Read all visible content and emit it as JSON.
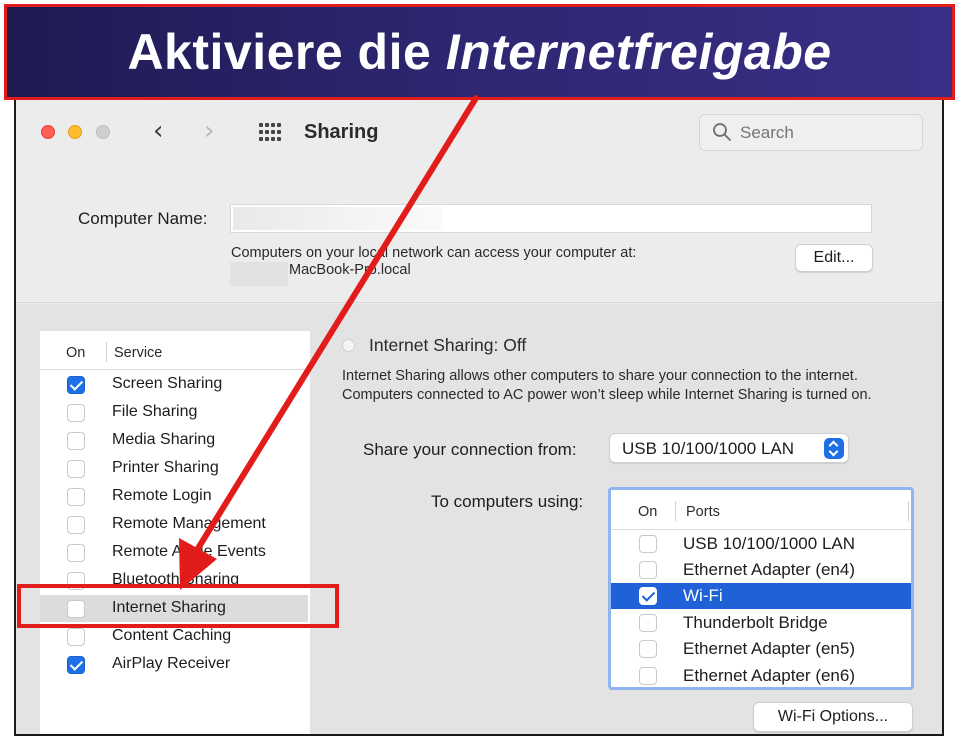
{
  "banner": {
    "title_plain": "Aktiviere die ",
    "title_emph": "Internetfreigabe"
  },
  "window": {
    "title": "Sharing",
    "search_placeholder": "Search"
  },
  "computer_name": {
    "label": "Computer Name:",
    "value": "",
    "info": "Computers on your local network can access your computer at:",
    "hostname": "MacBook-Pro.local",
    "edit_label": "Edit..."
  },
  "services": {
    "col_on": "On",
    "col_service": "Service",
    "items": [
      {
        "label": "Screen Sharing",
        "checked": true
      },
      {
        "label": "File Sharing",
        "checked": false
      },
      {
        "label": "Media Sharing",
        "checked": false
      },
      {
        "label": "Printer Sharing",
        "checked": false
      },
      {
        "label": "Remote Login",
        "checked": false
      },
      {
        "label": "Remote Management",
        "checked": false
      },
      {
        "label": "Remote Apple Events",
        "checked": false
      },
      {
        "label": "Bluetooth Sharing",
        "checked": false
      },
      {
        "label": "Internet Sharing",
        "checked": false,
        "selected": true
      },
      {
        "label": "Content Caching",
        "checked": false
      },
      {
        "label": "AirPlay Receiver",
        "checked": true
      }
    ]
  },
  "internet_sharing": {
    "status": "Internet Sharing: Off",
    "description": "Internet Sharing allows other computers to share your connection to the internet. Computers connected to AC power won’t sleep while Internet Sharing is turned on.",
    "share_from_label": "Share your connection from:",
    "share_from_value": "USB 10/100/1000 LAN",
    "to_label": "To computers using:",
    "ports_col_on": "On",
    "ports_col_ports": "Ports",
    "ports": [
      {
        "label": "USB 10/100/1000 LAN",
        "checked": false
      },
      {
        "label": "Ethernet Adapter (en4)",
        "checked": false
      },
      {
        "label": "Wi-Fi",
        "checked": true,
        "selected": true
      },
      {
        "label": "Thunderbolt Bridge",
        "checked": false
      },
      {
        "label": "Ethernet Adapter (en5)",
        "checked": false
      },
      {
        "label": "Ethernet Adapter (en6)",
        "checked": false
      }
    ],
    "wifi_options_label": "Wi-Fi Options..."
  },
  "colors": {
    "accent": "#1f6fe5",
    "annotation_red": "#e21b1b",
    "banner_bg": "#2d2670"
  }
}
